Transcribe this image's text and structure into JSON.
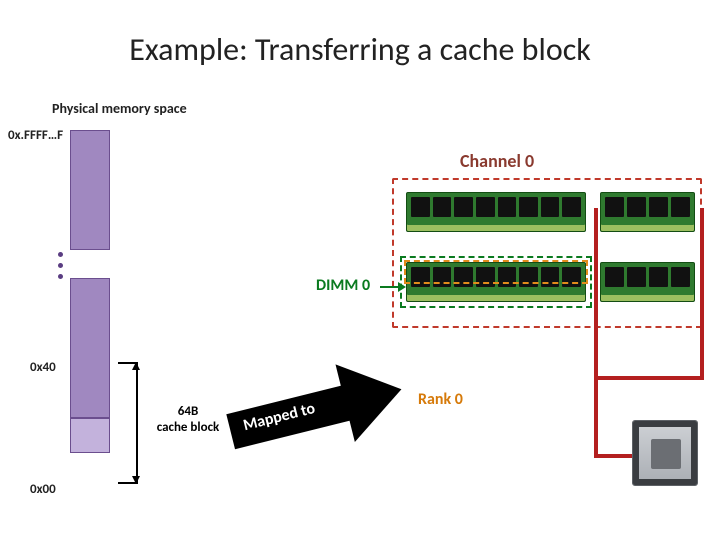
{
  "title": "Example: Transferring a cache block",
  "subtitle": "Physical memory space",
  "addresses": {
    "top": "0x.FFFF…F",
    "mid": "0x40",
    "bot": "0x00"
  },
  "cache_block": {
    "size_label_line1": "64B",
    "size_label_line2": "cache block"
  },
  "arrow_text": "Mapped to",
  "channel": {
    "label": "Channel 0"
  },
  "dimm": {
    "label": "DIMM 0"
  },
  "rank": {
    "label": "Rank 0"
  }
}
